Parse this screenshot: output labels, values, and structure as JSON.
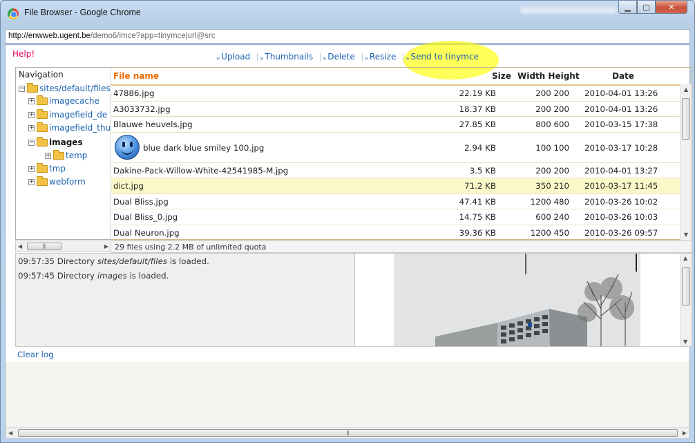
{
  "window": {
    "title": "File Browser - Google Chrome"
  },
  "address": {
    "host": "http://enwweb.ugent.be",
    "path": "/demo6/imce?app=tinymce|url@src"
  },
  "help": "Help!",
  "operations": [
    {
      "label": "Upload"
    },
    {
      "label": "Thumbnails"
    },
    {
      "label": "Delete"
    },
    {
      "label": "Resize"
    },
    {
      "label": "Send to tinymce"
    }
  ],
  "nav": {
    "header": "Navigation",
    "nodes": [
      {
        "label": "sites/default/files",
        "toggle": "−",
        "level": 0
      },
      {
        "label": "imagecache",
        "toggle": "+",
        "level": 1
      },
      {
        "label": "imagefield_de",
        "toggle": "+",
        "level": 1
      },
      {
        "label": "imagefield_thu",
        "toggle": "+",
        "level": 1
      },
      {
        "label": "images",
        "toggle": "−",
        "level": 1,
        "bold": true
      },
      {
        "label": "temp",
        "toggle": "+",
        "level": 2
      },
      {
        "label": "tmp",
        "toggle": "+",
        "level": 1
      },
      {
        "label": "webform",
        "toggle": "+",
        "level": 1
      }
    ]
  },
  "files": {
    "headers": {
      "name": "File name",
      "size": "Size",
      "wh": "Width Height",
      "date": "Date"
    },
    "rows": [
      {
        "name": "47886.jpg",
        "size": "22.19 KB",
        "wh": "200 200",
        "date": "2010-04-01 13:26"
      },
      {
        "name": "A3033732.jpg",
        "size": "18.37 KB",
        "wh": "200 200",
        "date": "2010-04-01 13:26"
      },
      {
        "name": "Blauwe heuvels.jpg",
        "size": "27.85 KB",
        "wh": "800 600",
        "date": "2010-03-15 17:38"
      },
      {
        "name": "blue dark blue smiley 100.jpg",
        "size": "2.94 KB",
        "wh": "100 100",
        "date": "2010-03-17 10:28",
        "thumb": true
      },
      {
        "name": "Dakine-Pack-Willow-White-42541985-M.jpg",
        "size": "3.5 KB",
        "wh": "200 200",
        "date": "2010-04-01 13:27"
      },
      {
        "name": "dict.jpg",
        "size": "71.2 KB",
        "wh": "350 210",
        "date": "2010-03-17 11:45",
        "selected": true
      },
      {
        "name": "Dual Bliss.jpg",
        "size": "47.41 KB",
        "wh": "1200 480",
        "date": "2010-03-26 10:02"
      },
      {
        "name": "Dual Bliss_0.jpg",
        "size": "14.75 KB",
        "wh": "600 240",
        "date": "2010-03-26 10:03"
      },
      {
        "name": "Dual Neuron.jpg",
        "size": "39.36 KB",
        "wh": "1200 450",
        "date": "2010-03-26 09:57"
      }
    ]
  },
  "status": "29 files using 2.2 MB of unlimited quota",
  "log": [
    {
      "time": "09:57:35",
      "pre": "Directory",
      "dir": "sites/default/files",
      "post": "is loaded."
    },
    {
      "time": "09:57:45",
      "pre": "Directory",
      "dir": "images",
      "post": "is loaded."
    }
  ],
  "clear_log": "Clear log",
  "icons": {
    "min": "minimize-icon",
    "max": "maximize-icon",
    "close": "close-icon"
  }
}
